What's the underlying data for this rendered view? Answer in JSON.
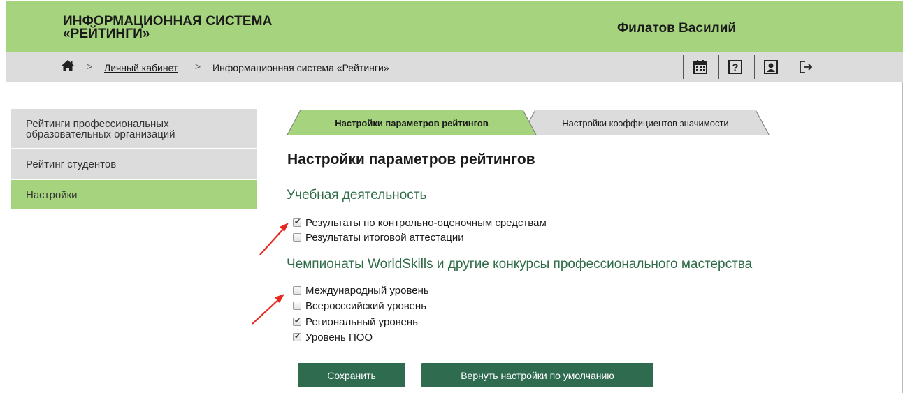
{
  "header": {
    "app_title_line1": "ИНФОРМАЦИОННАЯ СИСТЕМА",
    "app_title_line2": "«РЕЙТИНГИ»",
    "user_name": "Филатов Василий",
    "color": "#a6d47e"
  },
  "breadcrumb": {
    "home_icon": "home-icon",
    "items": [
      "Личный кабинет",
      "Информационная система «Рейтинги»"
    ]
  },
  "toolbar": {
    "icons": [
      "calendar-icon",
      "help-icon",
      "profile-icon",
      "logout-icon"
    ],
    "help_glyph": "?"
  },
  "sidebar": {
    "items": [
      {
        "label": "Рейтинги профессиональных образовательных организаций",
        "active": false
      },
      {
        "label": "Рейтинг студентов",
        "active": false
      },
      {
        "label": "Настройки",
        "active": true
      }
    ]
  },
  "tabs": [
    {
      "label": "Настройки параметров рейтингов",
      "active": true
    },
    {
      "label": "Настройки коэффициентов значимости",
      "active": false
    }
  ],
  "main": {
    "title": "Настройки параметров рейтингов",
    "sections": [
      {
        "title": "Учебная деятельность",
        "options": [
          {
            "label": "Результаты по контрольно-оценочным средствам",
            "checked": true
          },
          {
            "label": "Результаты итоговой аттестации",
            "checked": false
          }
        ]
      },
      {
        "title": "Чемпионаты WorldSkills и другие конкурсы профессионального мастерства",
        "options": [
          {
            "label": "Международный уровень",
            "checked": false
          },
          {
            "label": "Всеросссийский уровень",
            "checked": false
          },
          {
            "label": "Региональный уровень",
            "checked": true
          },
          {
            "label": "Уровень ПОО",
            "checked": true
          }
        ]
      }
    ]
  },
  "buttons": {
    "save": "Сохранить",
    "reset": "Вернуть настройки по умолчанию",
    "color": "#2e6b4f"
  },
  "annotation_color": "#e8281e"
}
